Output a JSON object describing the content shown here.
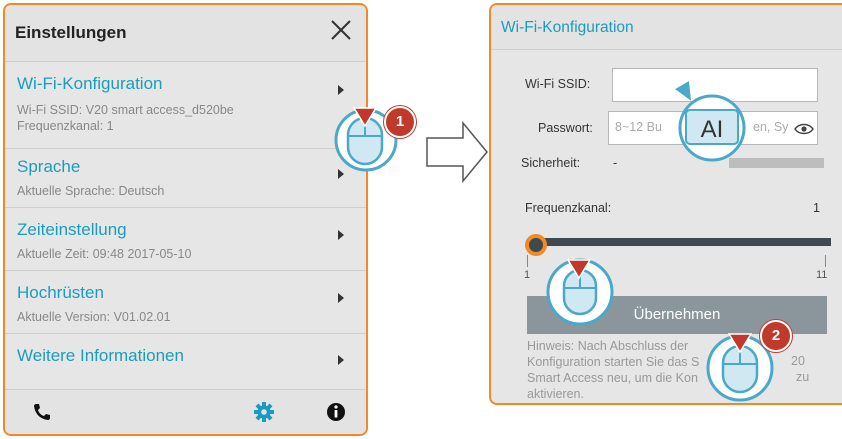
{
  "left_panel": {
    "title": "Einstellungen",
    "menu": [
      {
        "title": "Wi-Fi-Konfiguration",
        "lines": [
          "Wi-Fi SSID: V20 smart access_d520be",
          "Frequenzkanal: 1"
        ]
      },
      {
        "title": "Sprache",
        "lines": [
          "Aktuelle Sprache: Deutsch"
        ]
      },
      {
        "title": "Zeiteinstellung",
        "lines": [
          "Aktuelle Zeit: 09:48 2017-05-10"
        ]
      },
      {
        "title": "Hochrüsten",
        "lines": [
          "Aktuelle Version: V01.02.01"
        ]
      },
      {
        "title": "Weitere Informationen",
        "lines": []
      }
    ],
    "footer_icons": [
      "phone-icon",
      "gear-icon",
      "info-icon"
    ]
  },
  "right_panel": {
    "title": "Wi-Fi-Konfiguration",
    "ssid_label": "Wi-Fi SSID:",
    "ssid_value": "",
    "password_label": "Passwort:",
    "password_placeholder_left": "8~12 Bu",
    "password_placeholder_right": "en, Sy",
    "security_label": "Sicherheit:",
    "security_value": "-",
    "channel_label": "Frequenzkanal:",
    "channel_value": "1",
    "slider_min": "1",
    "slider_max": "11",
    "slider_fraction": 0.0,
    "apply_label": "Übernehmen",
    "hint_lines": [
      "Hinweis: Nach Abschluss der",
      "Konfiguration starten Sie das S",
      "Smart Access neu, um die Kon",
      "aktivieren."
    ],
    "hint_right_fragments": [
      "20",
      "zu"
    ]
  },
  "callouts": {
    "step1": "1",
    "step2": "2",
    "text_cursor_label": "AI"
  },
  "colors": {
    "accent_orange": "#f08a24",
    "link_blue": "#1a9cbf",
    "badge_red": "#c0392b",
    "cursor_blue": "#4aa8c8"
  }
}
